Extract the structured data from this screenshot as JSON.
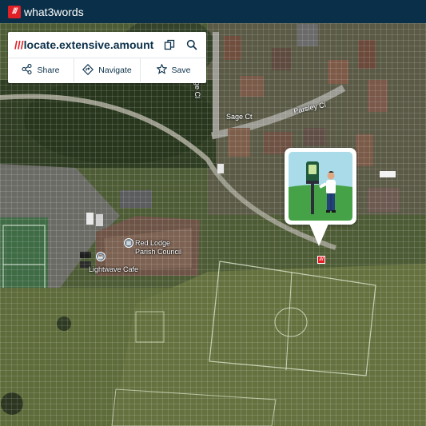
{
  "app": {
    "logo_mark": "///",
    "name": "what3words"
  },
  "search": {
    "slashes": "///",
    "address": "locate.extensive.amount",
    "copy_icon": "copy-icon",
    "search_icon": "search-icon"
  },
  "actions": [
    {
      "label": "Share",
      "icon": "share-icon"
    },
    {
      "label": "Navigate",
      "icon": "navigate-icon"
    },
    {
      "label": "Save",
      "icon": "star-icon"
    }
  ],
  "map": {
    "labels": {
      "sage_close": "Sage Cl",
      "sage_court": "Sage Ct",
      "parsley_close": "Parsley Cl",
      "red_lodge_1": "Red Lodge",
      "red_lodge_2": "Parish Council",
      "cafe": "Lightwave Cafe"
    },
    "pin_mark": "///"
  },
  "colors": {
    "brand_red": "#e11f26",
    "brand_navy": "#0a3049"
  }
}
